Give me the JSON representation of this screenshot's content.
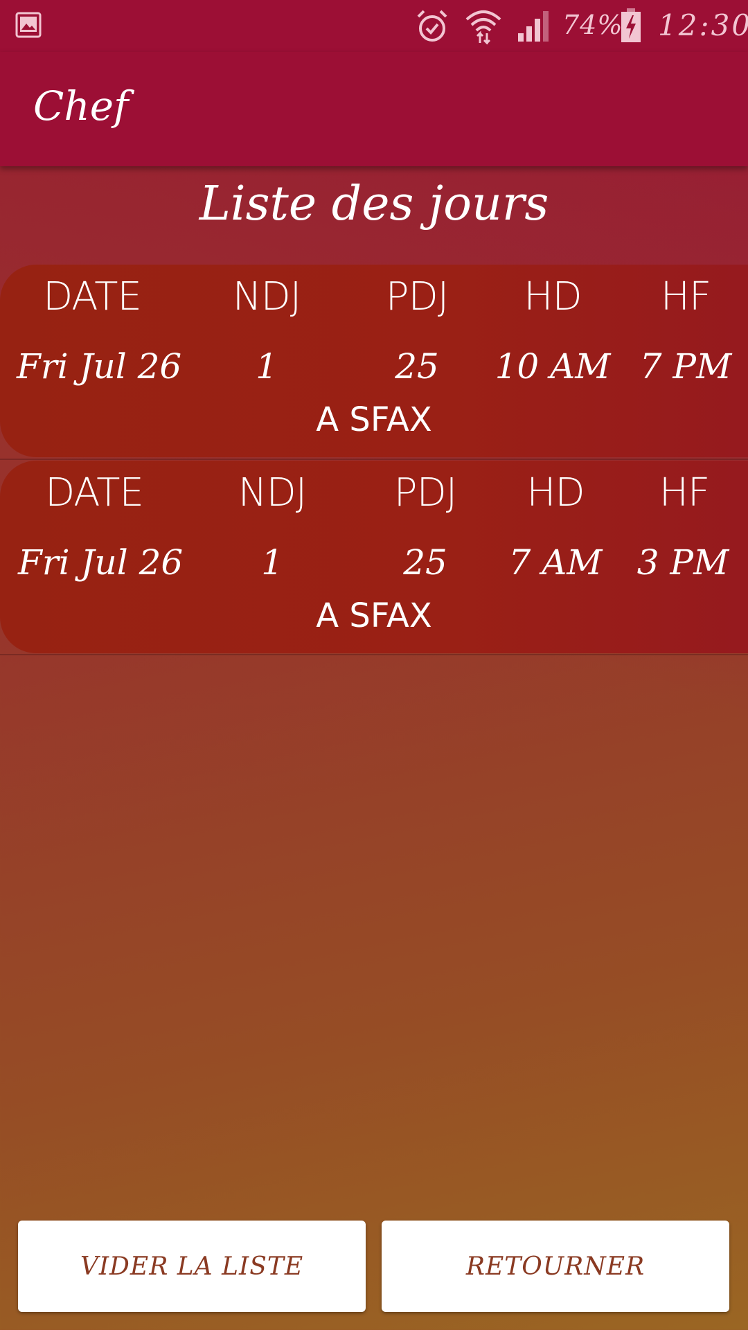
{
  "status_bar": {
    "battery_percent": "74%",
    "time": "12:30",
    "icons": [
      "gallery-icon",
      "alarm-icon",
      "wifi-icon",
      "signal-icon",
      "battery-charging-icon"
    ]
  },
  "app_bar": {
    "title": "Chef"
  },
  "page": {
    "title": "Liste des jours"
  },
  "list": {
    "headers": {
      "date": "DATE",
      "ndj": "NDJ",
      "pdj": "PDJ",
      "hd": "HD",
      "hf": "HF"
    },
    "items": [
      {
        "date": "Fri Jul 26",
        "ndj": "1",
        "pdj": "25",
        "hd": "10 AM",
        "hf": "7 PM",
        "location": "A SFAX"
      },
      {
        "date": "Fri Jul 26",
        "ndj": "1",
        "pdj": "25",
        "hd": "7 AM",
        "hf": "3 PM",
        "location": "A SFAX"
      }
    ]
  },
  "buttons": {
    "clear": "VIDER LA LISTE",
    "back": "RETOURNER"
  },
  "colors": {
    "primary": "#9c0f35",
    "card": "#972212",
    "button_text": "#8a3a22"
  }
}
